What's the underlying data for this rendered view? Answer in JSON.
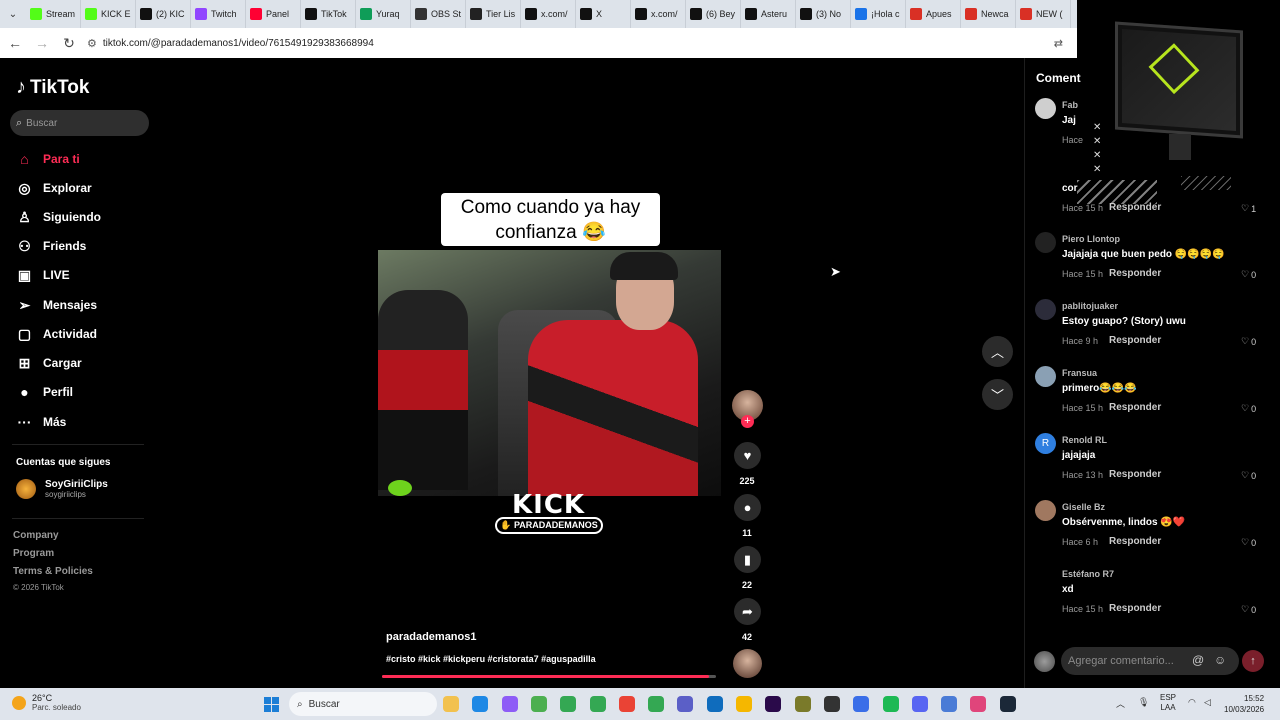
{
  "browser": {
    "tabs": [
      {
        "label": "Stream",
        "color": "#53fc18"
      },
      {
        "label": "KICK E",
        "color": "#53fc18"
      },
      {
        "label": "(2) KIC",
        "color": "#111111"
      },
      {
        "label": "Twitch",
        "color": "#9146ff"
      },
      {
        "label": "Panel",
        "color": "#ff0033"
      },
      {
        "label": "TikTok",
        "color": "#111111"
      },
      {
        "label": "Yuraq",
        "color": "#0f9d58"
      },
      {
        "label": "OBS St",
        "color": "#333333"
      },
      {
        "label": "Tier Lis",
        "color": "#222222"
      },
      {
        "label": "x.com/",
        "color": "#111111"
      },
      {
        "label": "X",
        "color": "#111111"
      },
      {
        "label": "x.com/",
        "color": "#111111"
      },
      {
        "label": "(6) Bey",
        "color": "#111111"
      },
      {
        "label": "Asteru",
        "color": "#111111"
      },
      {
        "label": "(3) No",
        "color": "#111111"
      },
      {
        "label": "¡Hola c",
        "color": "#1a73e8"
      },
      {
        "label": "Apues",
        "color": "#d93025"
      },
      {
        "label": "Newca",
        "color": "#d93025"
      },
      {
        "label": "NEW (",
        "color": "#d93025"
      }
    ],
    "url": "tiktok.com/@paradademanos1/video/7615491929383668994"
  },
  "sidebar": {
    "logo": "TikTok",
    "search_placeholder": "Buscar",
    "nav": [
      {
        "label": "Para ti",
        "icon": "home-icon",
        "glyph": "⌂"
      },
      {
        "label": "Explorar",
        "icon": "compass-icon",
        "glyph": "◎"
      },
      {
        "label": "Siguiendo",
        "icon": "following-icon",
        "glyph": "♙"
      },
      {
        "label": "Friends",
        "icon": "friends-icon",
        "glyph": "⚇"
      },
      {
        "label": "LIVE",
        "icon": "live-icon",
        "glyph": "▣"
      },
      {
        "label": "Mensajes",
        "icon": "messages-icon",
        "glyph": "➢"
      },
      {
        "label": "Actividad",
        "icon": "activity-icon",
        "glyph": "▢"
      },
      {
        "label": "Cargar",
        "icon": "upload-icon",
        "glyph": "⊞"
      },
      {
        "label": "Perfil",
        "icon": "profile-icon",
        "glyph": "●"
      },
      {
        "label": "Más",
        "icon": "more-icon",
        "glyph": "···"
      }
    ],
    "following_title": "Cuentas que sigues",
    "following": {
      "name": "SoyGiriiClips",
      "handle": "soygiriiclips"
    },
    "footer": [
      "Company",
      "Program",
      "Terms & Policies"
    ],
    "copyright": "© 2026 TikTok"
  },
  "video": {
    "caption_line1": "Como cuando ya hay",
    "caption_line2": "confianza 😂",
    "brand": "KICK",
    "brand_handle": "PARADADEMANOS",
    "author": "paradademanos1",
    "hashtags": "#cristo #kick #kickperu #cristorata7 #aguspadilla",
    "progress": 0.98
  },
  "actions": {
    "likes": "225",
    "comments": "11",
    "saves": "22",
    "shares": "42"
  },
  "comments": {
    "title": "Coment",
    "reply_label": "Responder",
    "items": [
      {
        "user": "Fab",
        "text": "Jaj",
        "time": "Hace",
        "likes": "",
        "avatar": "#cfcfcf"
      },
      {
        "user": "",
        "text": "cor",
        "time": "Hace 15 h",
        "likes": "1",
        "avatar": "#000000"
      },
      {
        "user": "Piero Llontop",
        "text": "Jajajaja que buen pedo 🤤🤤🤤🤤",
        "time": "Hace 15 h",
        "likes": "0",
        "avatar": "#222222"
      },
      {
        "user": "pablitojuaker",
        "text": "Estoy guapo? (Story) uwu",
        "time": "Hace 9 h",
        "likes": "0",
        "avatar": "#2c2c3a"
      },
      {
        "user": "Fransua",
        "text": "primero😂😂😂",
        "time": "Hace 15 h",
        "likes": "0",
        "avatar": "#8aa0b4"
      },
      {
        "user": "Renold RL",
        "text": "jajajaja",
        "time": "Hace 13 h",
        "likes": "0",
        "avatar": "#2f7fe0",
        "initial": "R"
      },
      {
        "user": "Giselle Bz",
        "text": "Obsérvenme, lindos 😍❤️",
        "time": "Hace 6 h",
        "likes": "0",
        "avatar": "#a07860"
      },
      {
        "user": "Estéfano R7",
        "text": "xd",
        "time": "Hace 15 h",
        "likes": "0",
        "avatar": "#000000"
      }
    ],
    "input_placeholder": "Agregar comentario..."
  },
  "taskbar": {
    "temperature": "26°C",
    "condition": "Parc. soleado",
    "search_placeholder": "Buscar",
    "lang_top": "ESP",
    "lang_bottom": "LAA",
    "time": "15:52",
    "date": "10/03/2026"
  }
}
